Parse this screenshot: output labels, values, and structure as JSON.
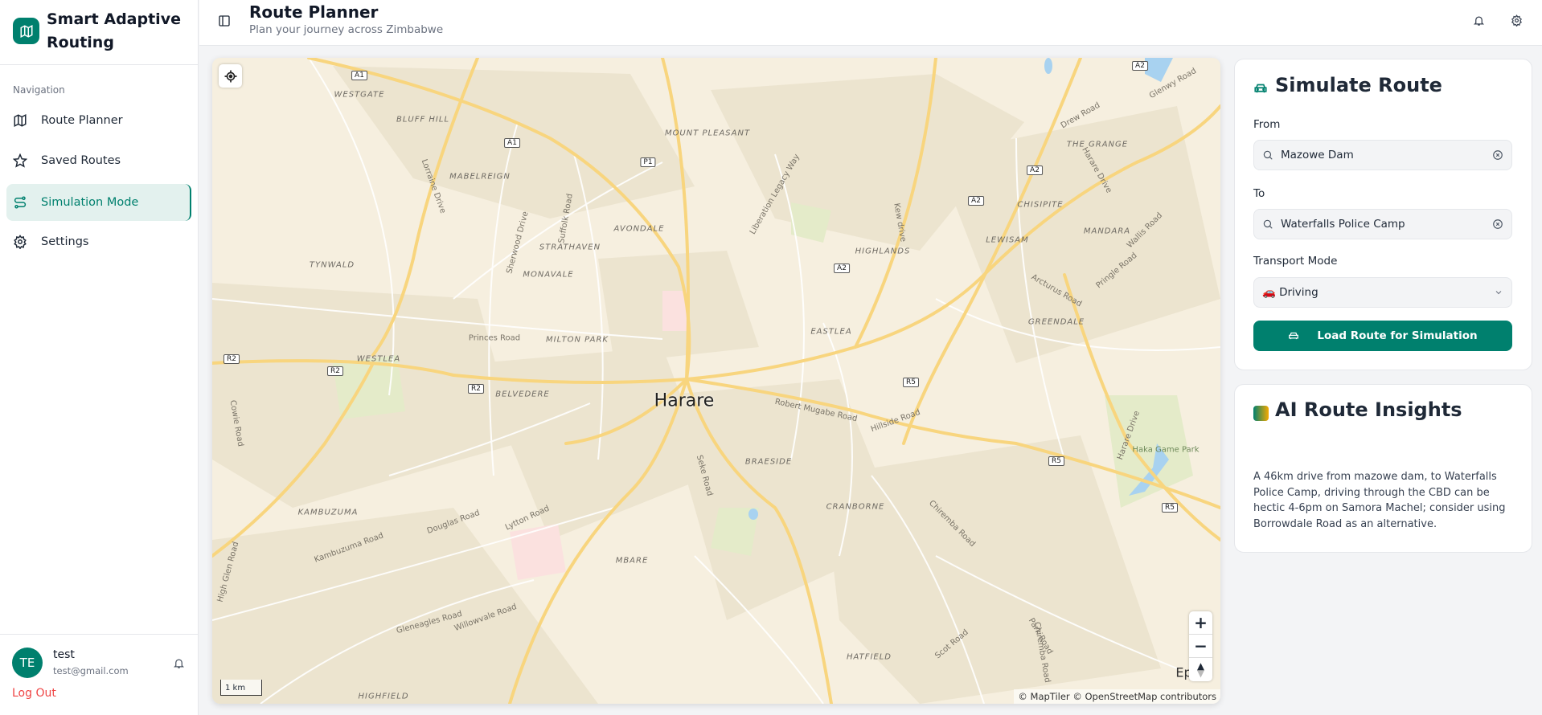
{
  "app": {
    "title": "Smart Adaptive Routing"
  },
  "sidebar": {
    "nav_label": "Navigation",
    "items": [
      {
        "label": "Route Planner",
        "icon": "map-icon"
      },
      {
        "label": "Saved Routes",
        "icon": "star-icon"
      },
      {
        "label": "Simulation Mode",
        "icon": "route-icon",
        "active": true
      },
      {
        "label": "Settings",
        "icon": "gear-icon"
      }
    ],
    "user": {
      "initials": "TE",
      "name": "test",
      "email": "test@gmail.com"
    },
    "logout": "Log Out"
  },
  "header": {
    "title": "Route Planner",
    "subtitle": "Plan your journey across Zimbabwe"
  },
  "map": {
    "city": "Harare",
    "suburbs": [
      "WESTGATE",
      "BLUFF HILL",
      "MOUNT PLEASANT",
      "MABELREIGN",
      "AVONDALE",
      "STRATHAVEN",
      "MONAVALE",
      "TYNWALD",
      "HIGHLANDS",
      "CHISIPITE",
      "LEWISAM",
      "GREENDALE",
      "EASTLEA",
      "MILTON PARK",
      "WESTLEA",
      "BELVEDERE",
      "BRAESIDE",
      "CRANBORNE",
      "KAMBUZUMA",
      "MBARE",
      "HATFIELD",
      "HIGHFIELD",
      "THE GRANGE",
      "MANDARA"
    ],
    "roads": [
      "Princes Road",
      "Robert Mugabe Road",
      "Liberation Legacy Way",
      "Harare Drive",
      "Sherwood Drive",
      "Suffolk Road",
      "Lorraine Drive",
      "Douglas Road",
      "Lytton Road",
      "Kambuzuma Road",
      "High Glen Road",
      "Gleneagles Road",
      "Willowvale Road",
      "Seke Road",
      "Chiremba Road",
      "Scot Road",
      "Park Road",
      "Arcturus Road",
      "Pringle Road",
      "Wallis Road",
      "Drew Road",
      "Glenwy Road",
      "Hillside Road",
      "Cowie Road",
      "Harare Drive",
      "Kew drive",
      "Chiremba Road"
    ],
    "places": [
      "Haka Game Park",
      "Epwo"
    ],
    "shields": [
      "A1",
      "A1",
      "P1",
      "A2",
      "A2",
      "A2",
      "A2",
      "R2",
      "R2",
      "R2",
      "R5",
      "R5",
      "R5"
    ],
    "scale": "1 km",
    "attribution": "© MapTiler © OpenStreetMap contributors",
    "colors": {
      "land": "#f6efdf",
      "major_road": "#f8d57e",
      "minor_road": "#ffffff",
      "urban": "#ece4cf",
      "park": "#e4ebc9",
      "water": "#a8d2f0"
    }
  },
  "simulate": {
    "title": "Simulate Route",
    "from_label": "From",
    "from_value": "Mazowe Dam",
    "to_label": "To",
    "to_value": "Waterfalls Police Camp",
    "mode_label": "Transport Mode",
    "mode_value": "🚗 Driving",
    "button": "Load Route for Simulation"
  },
  "insights": {
    "title": "AI Route Insights",
    "text": "A 46km drive from mazowe dam, to Waterfalls Police Camp, driving through the CBD can be hectic 4-6pm on Samora Machel; consider using Borrowdale Road as an alternative."
  },
  "theme": {
    "accent": "#00806e",
    "danger": "#ef4444"
  }
}
